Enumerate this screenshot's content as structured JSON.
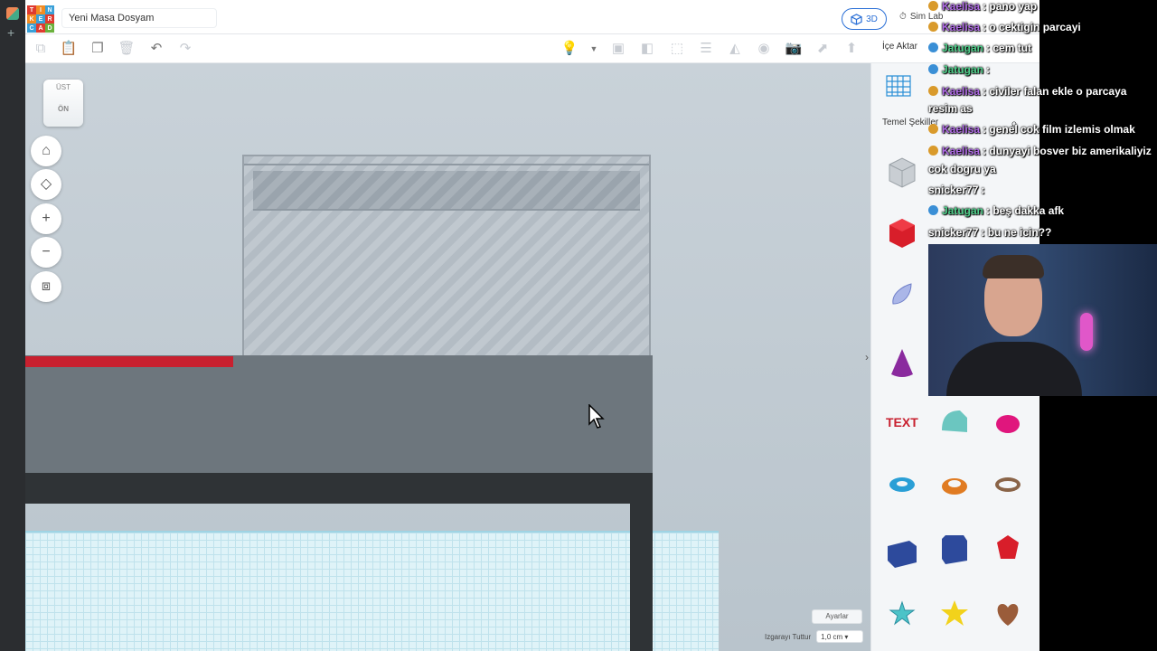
{
  "app": {
    "document_title": "Yeni Masa Dosyam",
    "logo_letters": [
      "T",
      "I",
      "N",
      "K",
      "E",
      "R",
      "C",
      "A",
      "D"
    ],
    "view_3d_label": "3D",
    "sim_lab_label": "Sim Lab",
    "import_label": "İçe Aktar",
    "viewcube_top": "ÜST",
    "viewcube_front": "ÖN",
    "settings_label": "Ayarlar",
    "snap_grid_label": "Izgarayı Tuttur",
    "snap_grid_value": "1,0 cm",
    "shapes_category": "Temel Şekiller"
  },
  "colors": {
    "accent": "#2a6fd6",
    "red_shape": "#c8202f",
    "workplane_grid": "#dff3f8"
  },
  "chat": [
    {
      "badge": "#d99a2b",
      "user": "Kaelisa",
      "user_color": "purple",
      "text": ": pano yap"
    },
    {
      "badge": "#d99a2b",
      "user": "Kaelisa",
      "user_color": "purple",
      "text": ": o cektigin parcayi"
    },
    {
      "badge": "#3a8fd6",
      "user": "Jatugan",
      "user_color": "green",
      "text": ": cem tut"
    },
    {
      "badge": "#3a8fd6",
      "user": "Jatugan",
      "user_color": "green",
      "text": ":"
    },
    {
      "badge": "#d99a2b",
      "user": "Kaelisa",
      "user_color": "purple",
      "text": ": civiler falan ekle o parcaya"
    },
    {
      "badge": "",
      "user": "",
      "user_color": "white",
      "text": "resim as"
    },
    {
      "badge": "#d99a2b",
      "user": "Kaelisa",
      "user_color": "purple",
      "text": ": genel cok film izlemis olmak"
    },
    {
      "badge": "#d99a2b",
      "user": "Kaelisa",
      "user_color": "purple",
      "text": ": dunyayi bosver biz amerikaliyiz"
    },
    {
      "badge": "",
      "user": "",
      "user_color": "white",
      "text": "cok dogru ya"
    },
    {
      "badge": "",
      "user": "snicker77",
      "user_color": "white",
      "text": ":"
    },
    {
      "badge": "#3a8fd6",
      "user": "Jatugan",
      "user_color": "green",
      "text": ": beş dakka afk"
    },
    {
      "badge": "",
      "user": "snicker77",
      "user_color": "white",
      "text": ": bu ne icin??"
    }
  ]
}
